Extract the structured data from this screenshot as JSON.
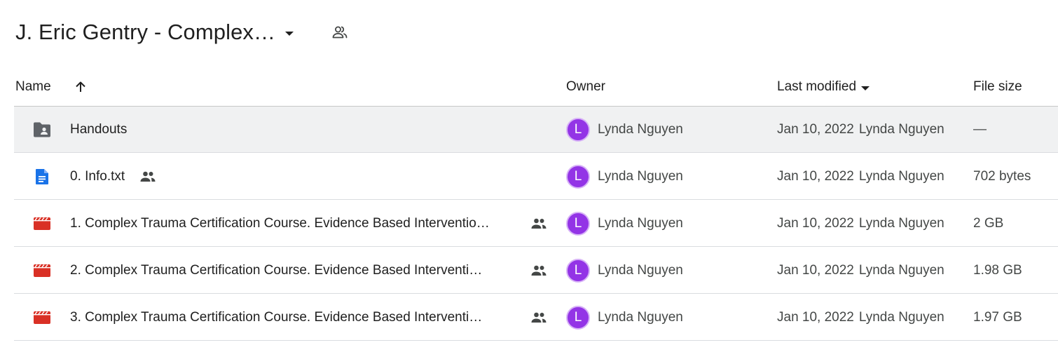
{
  "folder": {
    "title": "J. Eric Gentry - Complex…"
  },
  "columns": {
    "name": "Name",
    "owner": "Owner",
    "last_modified": "Last modified",
    "file_size": "File size"
  },
  "colors": {
    "folder_icon": "#5f6368",
    "doc_icon": "#1a73e8",
    "video_icon": "#d93025",
    "avatar_bg": "#9334e6",
    "selected_row_bg": "#f0f1f2"
  },
  "rows": [
    {
      "icon": "shared-folder-icon",
      "name": "Handouts",
      "shared": false,
      "owner_initial": "L",
      "owner": "Lynda Nguyen",
      "modified_date": "Jan 10, 2022",
      "modified_by": "Lynda Nguyen",
      "size": "—",
      "selected": true
    },
    {
      "icon": "google-doc-icon",
      "name": "0. Info.txt",
      "shared": true,
      "owner_initial": "L",
      "owner": "Lynda Nguyen",
      "modified_date": "Jan 10, 2022",
      "modified_by": "Lynda Nguyen",
      "size": "702 bytes",
      "selected": false
    },
    {
      "icon": "video-icon",
      "name": "1. Complex Trauma Certification Course.  Evidence Based Interventio…",
      "shared": true,
      "owner_initial": "L",
      "owner": "Lynda Nguyen",
      "modified_date": "Jan 10, 2022",
      "modified_by": "Lynda Nguyen",
      "size": "2 GB",
      "selected": false
    },
    {
      "icon": "video-icon",
      "name": "2. Complex Trauma Certification Course.  Evidence Based Interventi…",
      "shared": true,
      "owner_initial": "L",
      "owner": "Lynda Nguyen",
      "modified_date": "Jan 10, 2022",
      "modified_by": "Lynda Nguyen",
      "size": "1.98 GB",
      "selected": false
    },
    {
      "icon": "video-icon",
      "name": "3. Complex Trauma Certification Course.  Evidence Based Interventi…",
      "shared": true,
      "owner_initial": "L",
      "owner": "Lynda Nguyen",
      "modified_date": "Jan 10, 2022",
      "modified_by": "Lynda Nguyen",
      "size": "1.97 GB",
      "selected": false
    }
  ]
}
